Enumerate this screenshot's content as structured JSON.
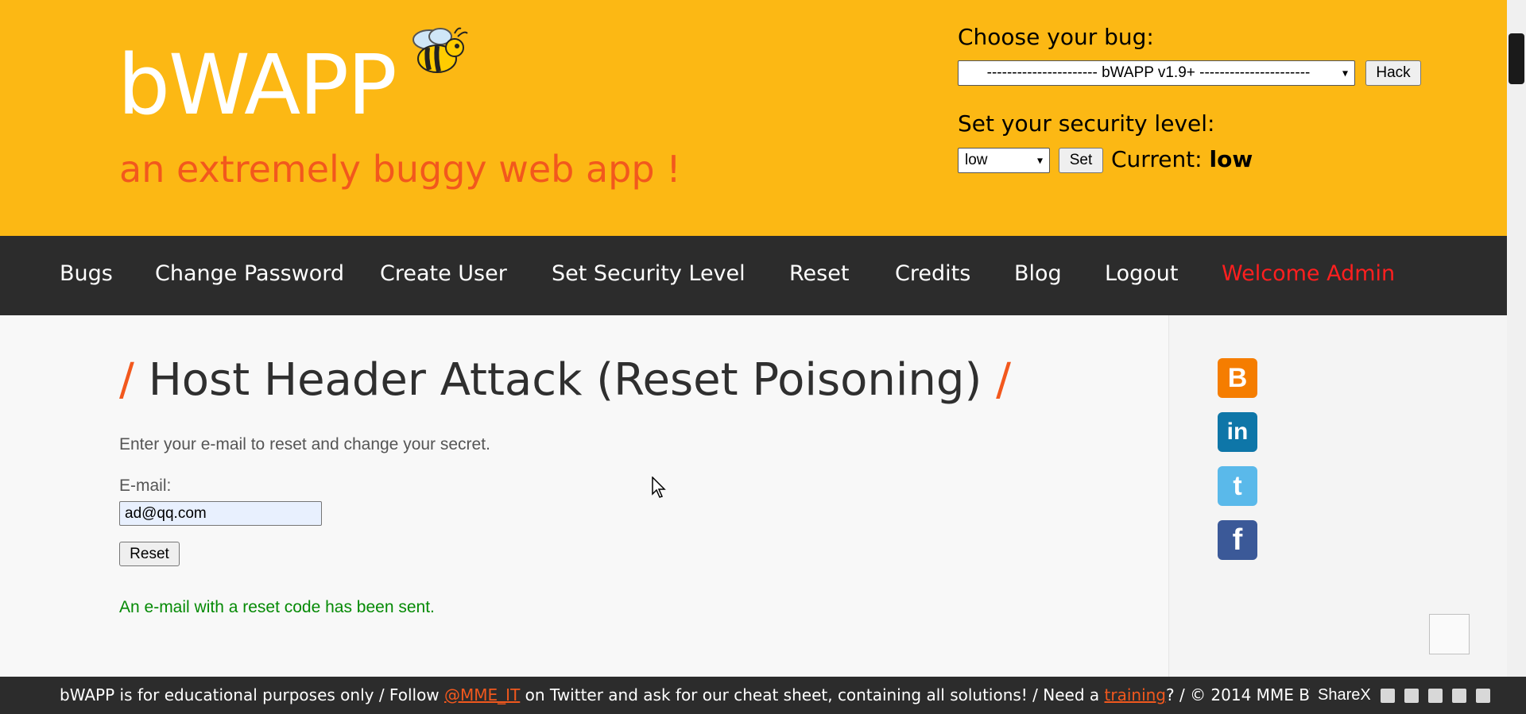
{
  "header": {
    "logo": "bWAPP",
    "tagline": "an extremely buggy web app !",
    "bug_label": "Choose your bug:",
    "bug_selected": "---------------------- bWAPP v1.9+ ----------------------",
    "hack_label": "Hack",
    "security_label": "Set your security level:",
    "security_selected": "low",
    "set_label": "Set",
    "current_label": "Current:",
    "current_value": "low"
  },
  "menu": {
    "items": [
      "Bugs",
      "Change Password",
      "Create User",
      "Set Security Level",
      "Reset",
      "Credits",
      "Blog",
      "Logout"
    ],
    "welcome": "Welcome Admin"
  },
  "main": {
    "title": "Host Header Attack (Reset Poisoning)",
    "title_slash": "/",
    "intro": "Enter your e-mail to reset and change your secret.",
    "email_label": "E-mail:",
    "email_value": "ad@qq.com",
    "reset_label": "Reset",
    "status": "An e-mail with a reset code has been sent."
  },
  "social": {
    "icons": [
      "blogger-icon",
      "linkedin-icon",
      "twitter-icon",
      "facebook-icon"
    ],
    "blogger_glyph": "B",
    "linkedin_glyph": "in",
    "twitter_glyph": "t",
    "facebook_glyph": "f"
  },
  "footer": {
    "part1": "bWAPP is for educational purposes only / Follow ",
    "twitter_link": "@MME_IT",
    "part2": " on Twitter and ask for our cheat sheet, containing all solutions! / Need a ",
    "training_link": "training",
    "part3": "? / © 2014 MME BV"
  },
  "taskbar": {
    "app": "ShareX"
  },
  "colors": {
    "header_bg": "#fcb814",
    "menu_bg": "#2c2c2c",
    "accent": "#f2581d",
    "welcome": "#ff1f1f",
    "success": "#058a05"
  }
}
